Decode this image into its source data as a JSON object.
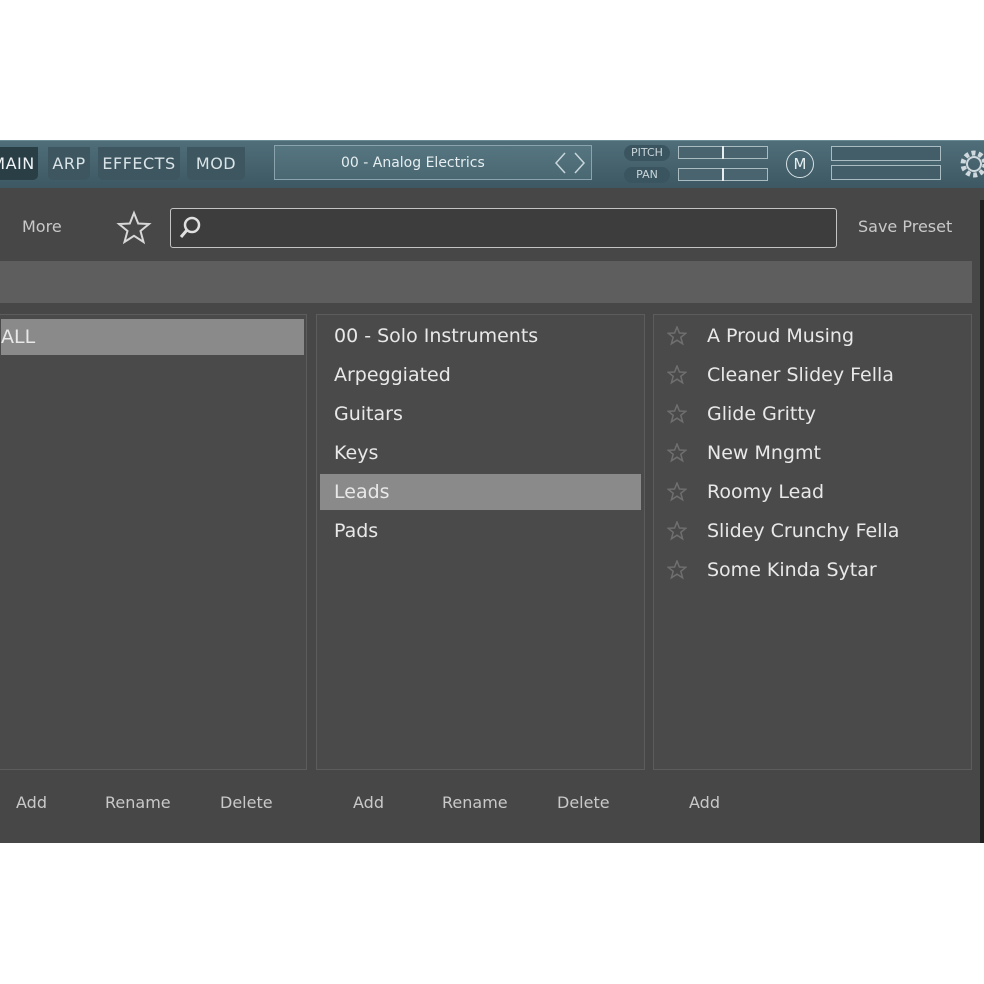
{
  "tabs": [
    {
      "label": "MAIN",
      "active": true
    },
    {
      "label": "ARP",
      "active": false
    },
    {
      "label": "EFFECTS",
      "active": false
    },
    {
      "label": "MOD",
      "active": false
    }
  ],
  "preset": {
    "name": "00 - Analog Electrics"
  },
  "controls": {
    "pitch_label": "PITCH",
    "pan_label": "PAN",
    "mono_label": "M"
  },
  "toolbar": {
    "more_label": "More",
    "save_preset_label": "Save Preset",
    "search_value": "",
    "search_placeholder": ""
  },
  "columns": {
    "banks": {
      "items": [
        {
          "label": "ALL",
          "selected": true
        }
      ],
      "buttons": [
        "Add",
        "Rename",
        "Delete"
      ]
    },
    "categories": {
      "items": [
        {
          "label": "00 - Solo Instruments",
          "selected": false
        },
        {
          "label": "Arpeggiated",
          "selected": false
        },
        {
          "label": "Guitars",
          "selected": false
        },
        {
          "label": "Keys",
          "selected": false
        },
        {
          "label": "Leads",
          "selected": true
        },
        {
          "label": "Pads",
          "selected": false
        }
      ],
      "buttons": [
        "Add",
        "Rename",
        "Delete"
      ]
    },
    "presets": {
      "items": [
        {
          "label": "A Proud Musing",
          "favorite": false
        },
        {
          "label": "Cleaner Slidey Fella",
          "favorite": false
        },
        {
          "label": "Glide Gritty",
          "favorite": false
        },
        {
          "label": "New Mngmt",
          "favorite": false
        },
        {
          "label": "Roomy Lead",
          "favorite": false
        },
        {
          "label": "Slidey Crunchy Fella",
          "favorite": false
        },
        {
          "label": "Some Kinda Sytar",
          "favorite": false
        }
      ],
      "buttons": [
        "Add"
      ]
    }
  },
  "icons": {
    "favorite": "star-outline-icon",
    "search": "magnifier-icon",
    "settings": "gear-icon",
    "nav": "chevron-left-right-icon"
  },
  "colors": {
    "topbar": "#45626c",
    "panel": "#474747",
    "selection": "#8a8a8a",
    "text": "#e8e8e8"
  }
}
